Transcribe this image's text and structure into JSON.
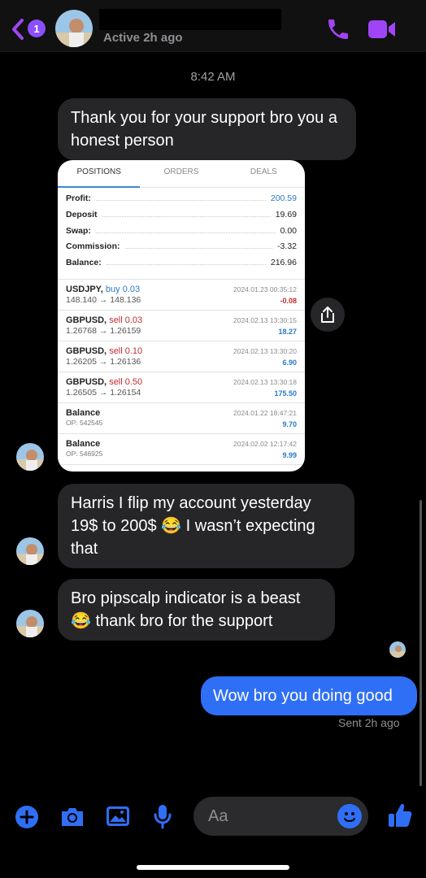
{
  "header": {
    "back_badge": "1",
    "status": "Active 2h ago",
    "colors": {
      "accent": "#a045f5",
      "badge": "#8a4fff"
    },
    "icons": {
      "back": "chevron-left-icon",
      "call": "phone-icon",
      "video": "video-camera-icon"
    }
  },
  "chat": {
    "timestamp": "8:42 AM",
    "messages": [
      {
        "from": "them",
        "text": "Thank you for your support bro you a honest person"
      },
      {
        "from": "them",
        "text": "Harris  I flip my account yesterday 19$ to 200$ 😂 I wasn’t expecting that"
      },
      {
        "from": "them",
        "text": "Bro pipscalp indicator is a beast 😂 thank bro for the support"
      },
      {
        "from": "me",
        "text": "Wow bro you doing good"
      }
    ],
    "sent_status": "Sent 2h ago"
  },
  "attachment": {
    "tabs": [
      "POSITIONS",
      "ORDERS",
      "DEALS"
    ],
    "summary": [
      {
        "label": "Profit:",
        "value": "200.59"
      },
      {
        "label": "Deposit",
        "value": "19.69"
      },
      {
        "label": "Swap:",
        "value": "0.00"
      },
      {
        "label": "Commission:",
        "value": "-3.32"
      },
      {
        "label": "Balance:",
        "value": "216.96"
      }
    ],
    "trades": [
      {
        "symbol": "USDJPY,",
        "action": "buy 0.03",
        "prices": "148.140 → 148.136",
        "date": "2024.01.23 00:35:12",
        "pl": "-0.08"
      },
      {
        "symbol": "GBPUSD,",
        "action": "sell 0.03",
        "prices": "1.26768 → 1.26159",
        "date": "2024.02.13 13:30:15",
        "pl": "18.27"
      },
      {
        "symbol": "GBPUSD,",
        "action": "sell 0.10",
        "prices": "1.26205 → 1.26136",
        "date": "2024.02.13 13:30:20",
        "pl": "6.90"
      },
      {
        "symbol": "GBPUSD,",
        "action": "sell 0.50",
        "prices": "1.26505 → 1.26154",
        "date": "2024.02.13 13:30:18",
        "pl": "175.50"
      },
      {
        "symbol": "Balance",
        "action": "",
        "prices": "OP: 542545",
        "date": "2024.01.22 18:47:21",
        "pl": "9.70"
      },
      {
        "symbol": "Balance",
        "action": "",
        "prices": "OP: 546925",
        "date": "2024.02.02 12:17:42",
        "pl": "9.99"
      }
    ]
  },
  "composer": {
    "placeholder": "Aa",
    "icons": [
      "plus-icon",
      "camera-icon",
      "photo-icon",
      "microphone-icon",
      "emoji-icon",
      "thumbs-up-icon"
    ],
    "accent": "#2f6ff6"
  }
}
